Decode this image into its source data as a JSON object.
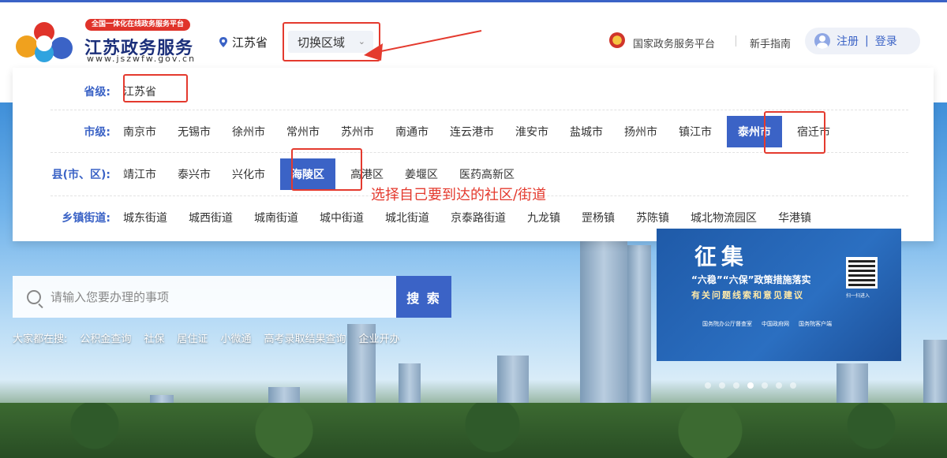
{
  "header": {
    "badge": "全国一体化在线政务服务平台",
    "title": "江苏政务服务",
    "url": "www.jszwfw.gov.cn",
    "location": "江苏省",
    "switch_label": "切换区域",
    "national_link": "国家政务服务平台",
    "guide_link": "新手指南",
    "register_label": "注册",
    "login_separator": "|",
    "login_label": "登录"
  },
  "region_panel": {
    "province_label": "省级:",
    "province_value": "江苏省",
    "city_label": "市级:",
    "cities": [
      "南京市",
      "无锡市",
      "徐州市",
      "常州市",
      "苏州市",
      "南通市",
      "连云港市",
      "淮安市",
      "盐城市",
      "扬州市",
      "镇江市",
      "泰州市",
      "宿迁市"
    ],
    "selected_city": "泰州市",
    "county_label": "县(市、区):",
    "counties": [
      "靖江市",
      "泰兴市",
      "兴化市",
      "海陵区",
      "高港区",
      "姜堰区",
      "医药高新区"
    ],
    "selected_county": "海陵区",
    "town_label": "乡镇街道:",
    "towns": [
      "城东街道",
      "城西街道",
      "城南街道",
      "城中街道",
      "城北街道",
      "京泰路街道",
      "九龙镇",
      "罡杨镇",
      "苏陈镇",
      "城北物流园区",
      "华港镇"
    ]
  },
  "annotation": {
    "note": "选择自己要到达的社区/街道",
    "highlight_color": "#e43a2e"
  },
  "search": {
    "placeholder": "请输入您要办理的事项",
    "button_label": "搜 索",
    "hot_prefix": "大家都在搜:",
    "hot_terms": [
      "公积金查询",
      "社保",
      "居住证",
      "小微通",
      "高考录取结果查询",
      "企业开办"
    ]
  },
  "banner": {
    "title": "征集",
    "line1": "“六稳”“六保”政策措施落实",
    "line2": "有关问题线索和意见建议",
    "qr_caption": "扫一扫进入",
    "footer": [
      "国务院办公厅督查室",
      "中国政府网",
      "国务院客户端"
    ],
    "slide_count": 7,
    "active_slide": 4
  },
  "colors": {
    "accent": "#3b63c6",
    "highlight": "#e43a2e"
  }
}
